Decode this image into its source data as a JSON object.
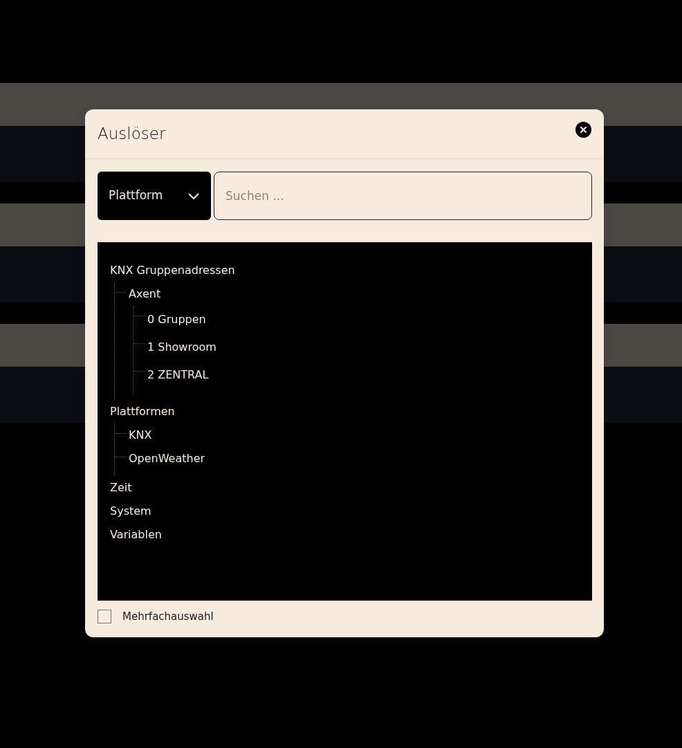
{
  "dialog": {
    "title": "Auslöser"
  },
  "filter": {
    "dropdown": "Plattform",
    "search_placeholder": "Suchen ..."
  },
  "tree": [
    {
      "label": "KNX Gruppenadressen",
      "children": [
        {
          "label": "Axent",
          "children": [
            {
              "label": "0 Gruppen"
            },
            {
              "label": "1 Showroom"
            },
            {
              "label": "2 ZENTRAL"
            }
          ]
        }
      ]
    },
    {
      "label": "Plattformen",
      "children": [
        {
          "label": "KNX"
        },
        {
          "label": "OpenWeather"
        }
      ]
    },
    {
      "label": "Zeit"
    },
    {
      "label": "System"
    },
    {
      "label": "Variablen"
    }
  ],
  "multi_select": {
    "label": "Mehrfachauswahl",
    "checked": false
  }
}
